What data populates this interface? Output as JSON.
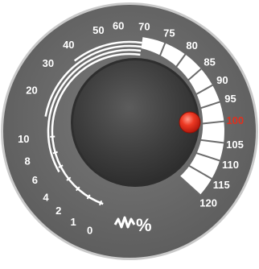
{
  "dial": {
    "scale_labels": [
      "0",
      "1",
      "2",
      "4",
      "6",
      "8",
      "10",
      "20",
      "30",
      "40",
      "50",
      "60",
      "70",
      "75",
      "80",
      "85",
      "90",
      "95",
      "100",
      "105",
      "110",
      "115",
      "120"
    ],
    "highlight_label": "100",
    "unit_label": "%",
    "selected_value": "100",
    "icon": "vibration-wave-icon",
    "colors": {
      "bezel": "#6b6b6b",
      "face": "#4f4f4f",
      "knob": "#3b3b3b",
      "label": "#ffffff",
      "highlight_label": "#e0301e",
      "indicator": "#e0301e",
      "high_band": "#ffffff"
    }
  }
}
